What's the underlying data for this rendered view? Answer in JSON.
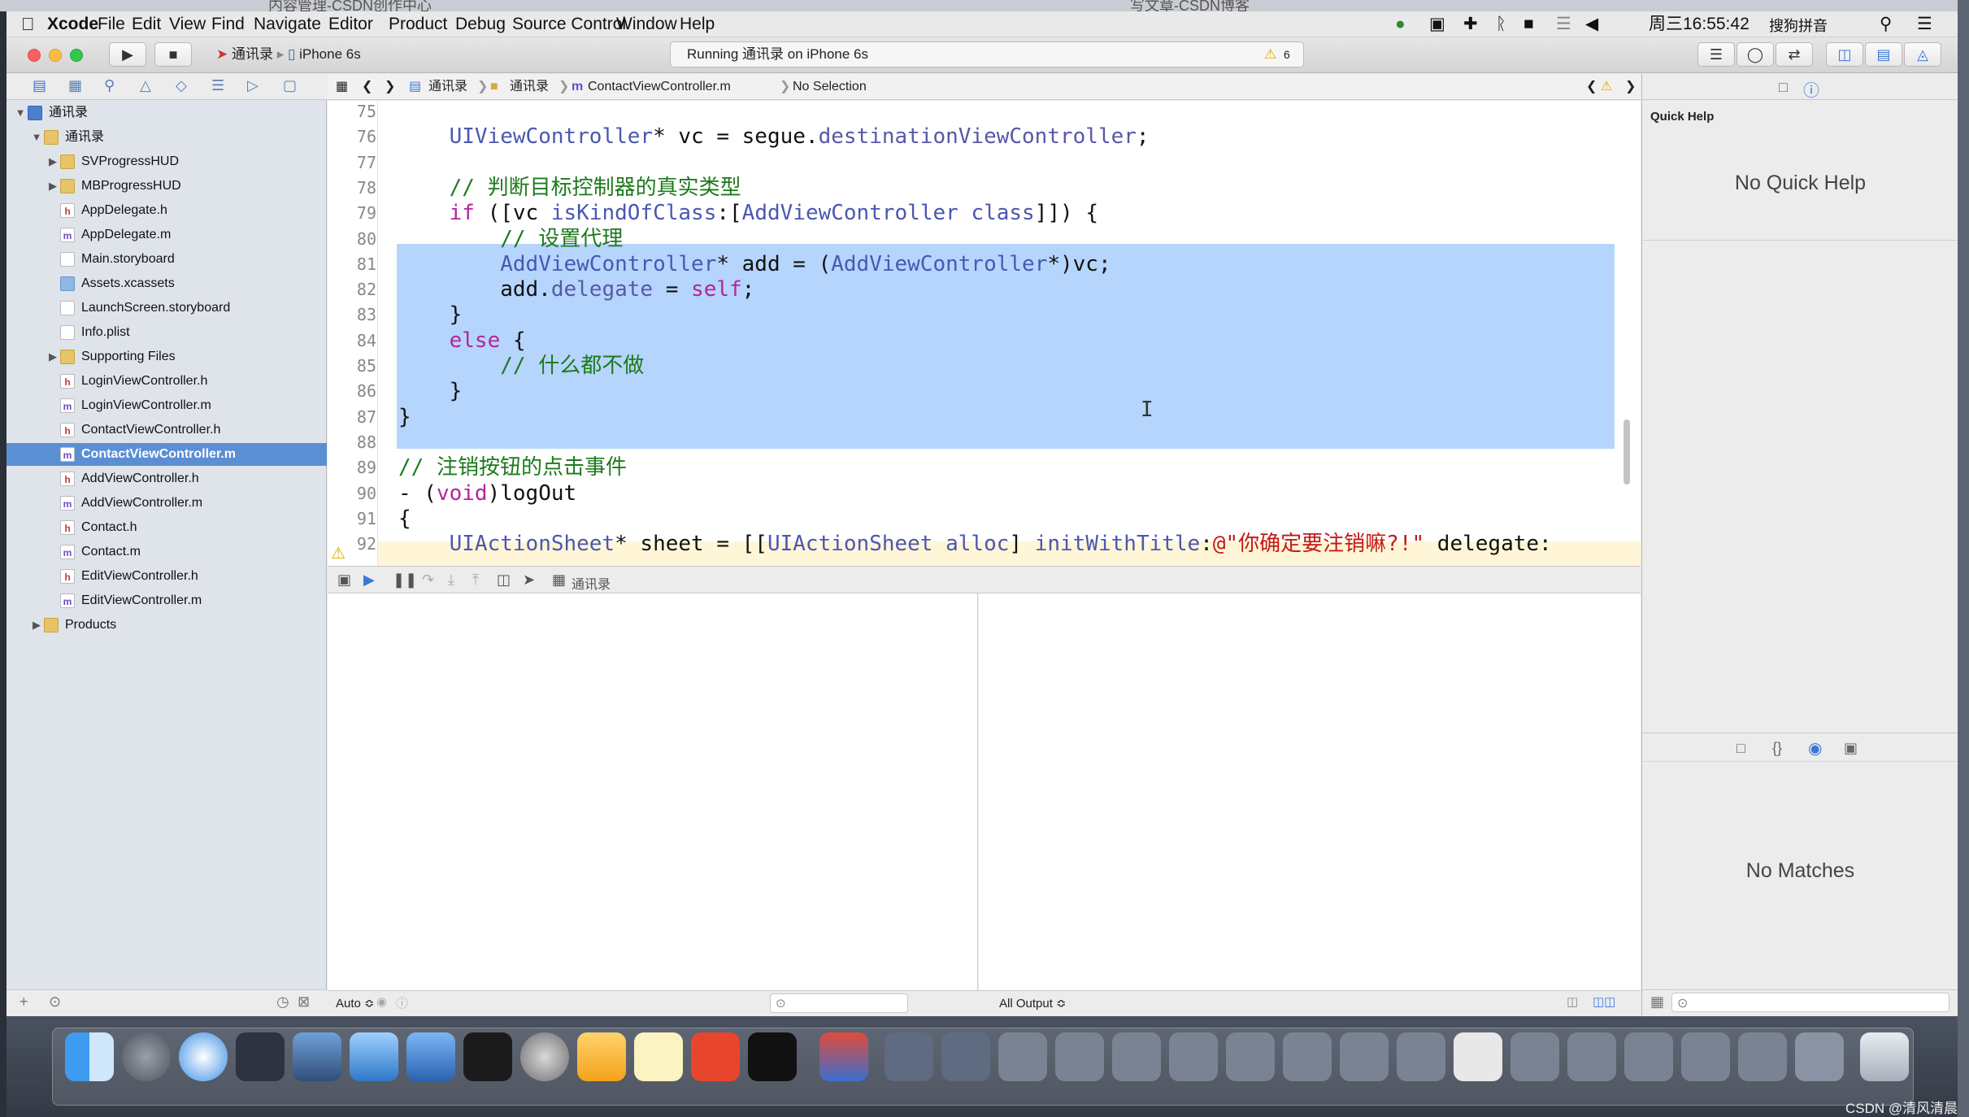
{
  "background": {
    "tab1": "内容管理-CSDN创作中心",
    "tab2": "写文章-CSDN博客"
  },
  "menubar": {
    "app": "Xcode",
    "items": [
      "File",
      "Edit",
      "View",
      "Find",
      "Navigate",
      "Editor",
      "Product",
      "Debug",
      "Source Control",
      "Window",
      "Help"
    ],
    "clock": "周三16:55:42",
    "ime": "搜狗拼音"
  },
  "toolbar": {
    "scheme_project": "通讯录",
    "scheme_device": "iPhone 6s",
    "status": "Running 通讯录 on iPhone 6s",
    "warning_count": "6"
  },
  "navigator": {
    "items": [
      {
        "label": "通讯录",
        "icon": "project",
        "indent": 0,
        "disclosure": "open"
      },
      {
        "label": "通讯录",
        "icon": "folder",
        "indent": 1,
        "disclosure": "open"
      },
      {
        "label": "SVProgressHUD",
        "icon": "folder",
        "indent": 2,
        "disclosure": "closed"
      },
      {
        "label": "MBProgressHUD",
        "icon": "folder",
        "indent": 2,
        "disclosure": "closed"
      },
      {
        "label": "AppDelegate.h",
        "icon": "h",
        "indent": 2
      },
      {
        "label": "AppDelegate.m",
        "icon": "m",
        "indent": 2
      },
      {
        "label": "Main.storyboard",
        "icon": "sb",
        "indent": 2
      },
      {
        "label": "Assets.xcassets",
        "icon": "assets",
        "indent": 2
      },
      {
        "label": "LaunchScreen.storyboard",
        "icon": "sb",
        "indent": 2
      },
      {
        "label": "Info.plist",
        "icon": "sb",
        "indent": 2
      },
      {
        "label": "Supporting Files",
        "icon": "folder",
        "indent": 2,
        "disclosure": "closed"
      },
      {
        "label": "LoginViewController.h",
        "icon": "h",
        "indent": 2
      },
      {
        "label": "LoginViewController.m",
        "icon": "m",
        "indent": 2
      },
      {
        "label": "ContactViewController.h",
        "icon": "h",
        "indent": 2
      },
      {
        "label": "ContactViewController.m",
        "icon": "m",
        "indent": 2,
        "selected": true
      },
      {
        "label": "AddViewController.h",
        "icon": "h",
        "indent": 2
      },
      {
        "label": "AddViewController.m",
        "icon": "m",
        "indent": 2
      },
      {
        "label": "Contact.h",
        "icon": "h",
        "indent": 2
      },
      {
        "label": "Contact.m",
        "icon": "m",
        "indent": 2
      },
      {
        "label": "EditViewController.h",
        "icon": "h",
        "indent": 2
      },
      {
        "label": "EditViewController.m",
        "icon": "m",
        "indent": 2
      },
      {
        "label": "Products",
        "icon": "folder",
        "indent": 1,
        "disclosure": "closed"
      }
    ]
  },
  "jumpbar": {
    "crumbs": [
      "通讯录",
      "通讯录",
      "ContactViewController.m",
      "No Selection"
    ]
  },
  "editor": {
    "lines": [
      {
        "n": "75",
        "tokens": []
      },
      {
        "n": "76",
        "tokens": [
          [
            "",
            "    "
          ],
          [
            "ty",
            "UIViewController"
          ],
          [
            "",
            "* vc = segue."
          ],
          [
            "pr",
            "destinationViewController"
          ],
          [
            "",
            ";"
          ]
        ]
      },
      {
        "n": "77",
        "tokens": []
      },
      {
        "n": "78",
        "tokens": [
          [
            "",
            "    "
          ],
          [
            "cm",
            "// 判断目标控制器的真实类型"
          ]
        ]
      },
      {
        "n": "79",
        "tokens": [
          [
            "",
            "    "
          ],
          [
            "kw",
            "if"
          ],
          [
            "",
            " ([vc "
          ],
          [
            "ty",
            "isKindOfClass"
          ],
          [
            "",
            ":["
          ],
          [
            "ty",
            "AddViewController"
          ],
          [
            "",
            " "
          ],
          [
            "ty",
            "class"
          ],
          [
            "",
            "]]) {"
          ]
        ]
      },
      {
        "n": "80",
        "tokens": [
          [
            "",
            "        "
          ],
          [
            "cm",
            "// 设置代理"
          ]
        ]
      },
      {
        "n": "81",
        "tokens": [
          [
            "",
            "        "
          ],
          [
            "ty",
            "AddViewController"
          ],
          [
            "",
            "* add = ("
          ],
          [
            "ty",
            "AddViewController"
          ],
          [
            "",
            "*)vc;"
          ]
        ]
      },
      {
        "n": "82",
        "tokens": [
          [
            "",
            "        add."
          ],
          [
            "pr",
            "delegate"
          ],
          [
            "",
            " = "
          ],
          [
            "kw",
            "self"
          ],
          [
            "",
            ";"
          ]
        ]
      },
      {
        "n": "83",
        "tokens": [
          [
            "",
            "    }"
          ]
        ]
      },
      {
        "n": "84",
        "tokens": [
          [
            "",
            "    "
          ],
          [
            "kw",
            "else"
          ],
          [
            "",
            " {"
          ]
        ]
      },
      {
        "n": "85",
        "tokens": [
          [
            "",
            "        "
          ],
          [
            "cm",
            "// 什么都不做"
          ]
        ]
      },
      {
        "n": "86",
        "tokens": [
          [
            "",
            "    }"
          ]
        ]
      },
      {
        "n": "87",
        "tokens": [
          [
            "",
            "}"
          ]
        ]
      },
      {
        "n": "88",
        "tokens": []
      },
      {
        "n": "89",
        "tokens": [
          [
            "cm",
            "// 注销按钮的点击事件"
          ]
        ]
      },
      {
        "n": "90",
        "tokens": [
          [
            "",
            "- ("
          ],
          [
            "kw",
            "void"
          ],
          [
            "",
            ")logOut"
          ]
        ]
      },
      {
        "n": "91",
        "tokens": [
          [
            "",
            "{"
          ]
        ]
      },
      {
        "n": "92",
        "tokens": [
          [
            "",
            "    "
          ],
          [
            "ty",
            "UIActionSheet"
          ],
          [
            "",
            "* sheet = [["
          ],
          [
            "ty",
            "UIActionSheet"
          ],
          [
            "",
            " "
          ],
          [
            "ty",
            "alloc"
          ],
          [
            "",
            "] "
          ],
          [
            "ty",
            "initWithTitle"
          ],
          [
            "",
            ":"
          ],
          [
            "st",
            "@\"你确定要注销嘛?!\""
          ],
          [
            "",
            " delegate:"
          ]
        ]
      }
    ]
  },
  "debug": {
    "target": "通讯录",
    "auto_label": "Auto ≎",
    "output_label": "All Output ≎"
  },
  "inspector": {
    "quick_help_title": "Quick Help",
    "no_quick_help": "No Quick Help",
    "no_matches": "No Matches"
  },
  "watermark": "CSDN @清风清晨",
  "colors": {
    "selection": "#b5d5fd",
    "keyword": "#b4259a",
    "comment": "#1d7a1d",
    "type": "#4b57b1",
    "string": "#c41a16",
    "nav_selected": "#5b8fd3"
  }
}
